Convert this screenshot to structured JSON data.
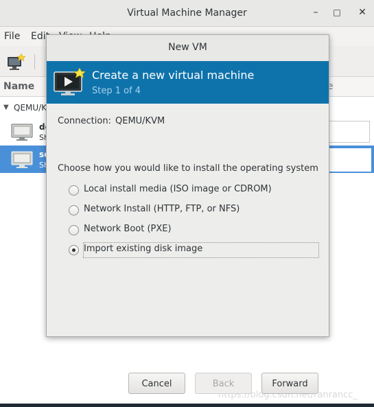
{
  "main_window": {
    "title": "Virtual Machine Manager",
    "controls": {
      "minimize": "–",
      "maximize": "□",
      "close": "✕"
    },
    "menus": [
      "File",
      "Edit",
      "View",
      "Help"
    ],
    "list": {
      "column_name": "Name",
      "column_right": "e",
      "connection": "QEMU/KVM",
      "vms": [
        {
          "name": "de",
          "status": "Sh"
        },
        {
          "name": "se",
          "status": "Sh"
        }
      ]
    }
  },
  "watermark": "https://blog.csdn.net/ranrancc_",
  "dialog": {
    "title": "New VM",
    "banner_title": "Create a new virtual machine",
    "banner_step": "Step 1 of 4",
    "connection_label": "Connection:",
    "connection_value": "QEMU/KVM",
    "choose_prompt": "Choose how you would like to install the operating system",
    "options": [
      {
        "label": "Local install media (ISO image or CDROM)",
        "selected": false
      },
      {
        "label": "Network Install (HTTP, FTP, or NFS)",
        "selected": false
      },
      {
        "label": "Network Boot (PXE)",
        "selected": false
      },
      {
        "label": "Import existing disk image",
        "selected": true
      }
    ],
    "buttons": {
      "cancel": "Cancel",
      "back": "Back",
      "forward": "Forward"
    }
  },
  "colors": {
    "banner": "#0f73ab",
    "selection": "#4a90d9"
  }
}
